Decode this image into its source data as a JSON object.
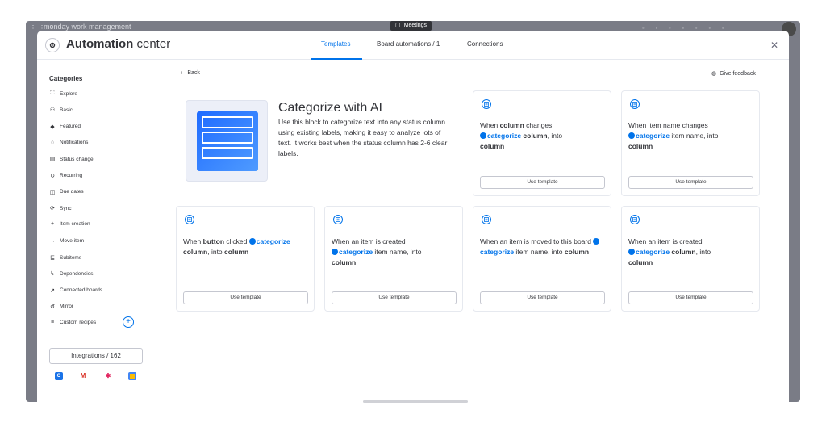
{
  "backdrop": {
    "brand": "monday work management",
    "meeting_label": "Meetings"
  },
  "header": {
    "title_bold": "Automation",
    "title_rest": " center",
    "tabs": [
      "Templates",
      "Board automations / 1",
      "Connections"
    ],
    "active_tab": 0
  },
  "sidebar": {
    "title": "Categories",
    "items": [
      {
        "icon": "explore-icon",
        "glyph": "⛶",
        "label": "Explore"
      },
      {
        "icon": "basic-icon",
        "glyph": "⚇",
        "label": "Basic"
      },
      {
        "icon": "featured-icon",
        "glyph": "◆",
        "label": "Featured"
      },
      {
        "icon": "bell-icon",
        "glyph": "♢",
        "label": "Notifications"
      },
      {
        "icon": "status-icon",
        "glyph": "▤",
        "label": "Status change"
      },
      {
        "icon": "recurring-icon",
        "glyph": "↻",
        "label": "Recurring"
      },
      {
        "icon": "calendar-icon",
        "glyph": "◫",
        "label": "Due dates"
      },
      {
        "icon": "sync-icon",
        "glyph": "⟳",
        "label": "Sync"
      },
      {
        "icon": "plus-icon",
        "glyph": "+",
        "label": "Item creation"
      },
      {
        "icon": "arrow-right-icon",
        "glyph": "→",
        "label": "Move item"
      },
      {
        "icon": "subitems-icon",
        "glyph": "⊑",
        "label": "Subitems"
      },
      {
        "icon": "dependencies-icon",
        "glyph": "↳",
        "label": "Dependencies"
      },
      {
        "icon": "connected-icon",
        "glyph": "↗",
        "label": "Connected boards"
      },
      {
        "icon": "mirror-icon",
        "glyph": "↺",
        "label": "Mirror"
      },
      {
        "icon": "custom-icon",
        "glyph": "≡",
        "label": "Custom recipes"
      }
    ],
    "integrations_label": "Integrations / 162"
  },
  "nav": {
    "back_label": "Back",
    "feedback_label": "Give feedback"
  },
  "hero": {
    "title": "Categorize with AI",
    "description": "Use this block to categorize text into any status column using existing labels, making it easy to analyze lots of text. It works best when the status column has 2-6 clear labels."
  },
  "cards": [
    {
      "parts": [
        [
          "t",
          "When "
        ],
        [
          "b",
          "column"
        ],
        [
          "t",
          " changes "
        ],
        [
          "br",
          ""
        ],
        [
          "dot",
          ""
        ],
        [
          "ai",
          "categorize "
        ],
        [
          "b",
          "column"
        ],
        [
          "t",
          ", into "
        ],
        [
          "br",
          ""
        ],
        [
          "b",
          "column"
        ]
      ],
      "button": "Use template"
    },
    {
      "parts": [
        [
          "t",
          "When item name changes "
        ],
        [
          "br",
          ""
        ],
        [
          "dot",
          ""
        ],
        [
          "ai",
          "categorize "
        ],
        [
          "t",
          "item name, into "
        ],
        [
          "br",
          ""
        ],
        [
          "b",
          "column"
        ]
      ],
      "button": "Use template"
    },
    {
      "parts": [
        [
          "t",
          "When "
        ],
        [
          "b",
          "button"
        ],
        [
          "t",
          " clicked "
        ],
        [
          "dot",
          ""
        ],
        [
          "ai",
          "categorize "
        ],
        [
          "b",
          "column"
        ],
        [
          "t",
          ", into "
        ],
        [
          "b",
          "column"
        ]
      ],
      "button": "Use template"
    },
    {
      "parts": [
        [
          "t",
          "When an item is created "
        ],
        [
          "br",
          ""
        ],
        [
          "dot",
          ""
        ],
        [
          "ai",
          "categorize "
        ],
        [
          "t",
          "item name, into "
        ],
        [
          "br",
          ""
        ],
        [
          "b",
          "column"
        ]
      ],
      "button": "Use template"
    },
    {
      "parts": [
        [
          "t",
          "When an item is moved to this board "
        ],
        [
          "dot",
          ""
        ],
        [
          "ai",
          "categorize "
        ],
        [
          "t",
          "item name, into "
        ],
        [
          "b",
          "column"
        ]
      ],
      "button": "Use template"
    },
    {
      "parts": [
        [
          "t",
          "When an item is created "
        ],
        [
          "br",
          ""
        ],
        [
          "dot",
          ""
        ],
        [
          "ai",
          "categorize "
        ],
        [
          "b",
          "column"
        ],
        [
          "t",
          ", into "
        ],
        [
          "br",
          ""
        ],
        [
          "b",
          "column"
        ]
      ],
      "button": "Use template"
    }
  ],
  "colors": {
    "accent": "#0073ea",
    "text": "#323338"
  }
}
